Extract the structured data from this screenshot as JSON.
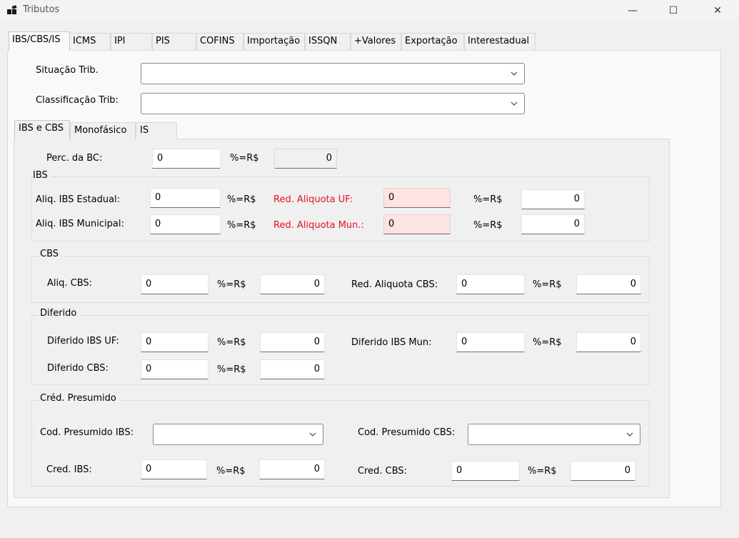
{
  "window": {
    "title": "Tributos",
    "controls": {
      "minimize": "—",
      "maximize": "☐",
      "close": "✕"
    }
  },
  "tabs": [
    "IBS/CBS/IS",
    "ICMS",
    "IPI",
    "PIS",
    "COFINS",
    "Importação",
    "ISSQN",
    "+Valores",
    "Exportação",
    "Interestadual"
  ],
  "top_fields": {
    "situacao_label": "Situação Trib.",
    "situacao_value": "",
    "classificacao_label": "Classificação Trib:",
    "classificacao_value": ""
  },
  "subtabs": [
    "IBS e CBS",
    "Monofásico",
    "IS"
  ],
  "perc_bc": {
    "label": "Perc. da BC:",
    "value": "0",
    "unit": "%=R$",
    "result": "0"
  },
  "ibs": {
    "title": "IBS",
    "estadual_label": "Aliq. IBS Estadual:",
    "estadual_value": "0",
    "estadual_unit": "%=R$",
    "red_uf_label": "Red. Aliquota UF:",
    "red_uf_value": "0",
    "red_uf_unit": "%=R$",
    "red_uf_result": "0",
    "municipal_label": "Aliq. IBS Municipal:",
    "municipal_value": "0",
    "municipal_unit": "%=R$",
    "red_mun_label": "Red. Aliquota Mun.:",
    "red_mun_value": "0",
    "red_mun_unit": "%=R$",
    "red_mun_result": "0"
  },
  "cbs": {
    "title": "CBS",
    "aliq_label": "Aliq. CBS:",
    "aliq_value": "0",
    "aliq_unit": "%=R$",
    "aliq_result": "0",
    "red_label": "Red. Aliquota CBS:",
    "red_value": "0",
    "red_unit": "%=R$",
    "red_result": "0"
  },
  "diferido": {
    "title": "Diferido",
    "ibs_uf_label": "Diferido IBS UF:",
    "ibs_uf_value": "0",
    "ibs_uf_unit": "%=R$",
    "ibs_uf_result": "0",
    "ibs_mun_label": "Diferido IBS Mun:",
    "ibs_mun_value": "0",
    "ibs_mun_unit": "%=R$",
    "ibs_mun_result": "0",
    "cbs_label": "Diferido CBS:",
    "cbs_value": "0",
    "cbs_unit": "%=R$",
    "cbs_result": "0"
  },
  "cred_presumido": {
    "title": "Créd. Presumido",
    "cod_ibs_label": "Cod. Presumido IBS:",
    "cod_ibs_value": "",
    "cod_cbs_label": "Cod. Presumido CBS:",
    "cod_cbs_value": "",
    "cred_ibs_label": "Cred. IBS:",
    "cred_ibs_value": "0",
    "cred_ibs_unit": "%=R$",
    "cred_ibs_result": "0",
    "cred_cbs_label": "Cred. CBS:",
    "cred_cbs_value": "0",
    "cred_cbs_unit": "%=R$",
    "cred_cbs_result": "0"
  }
}
